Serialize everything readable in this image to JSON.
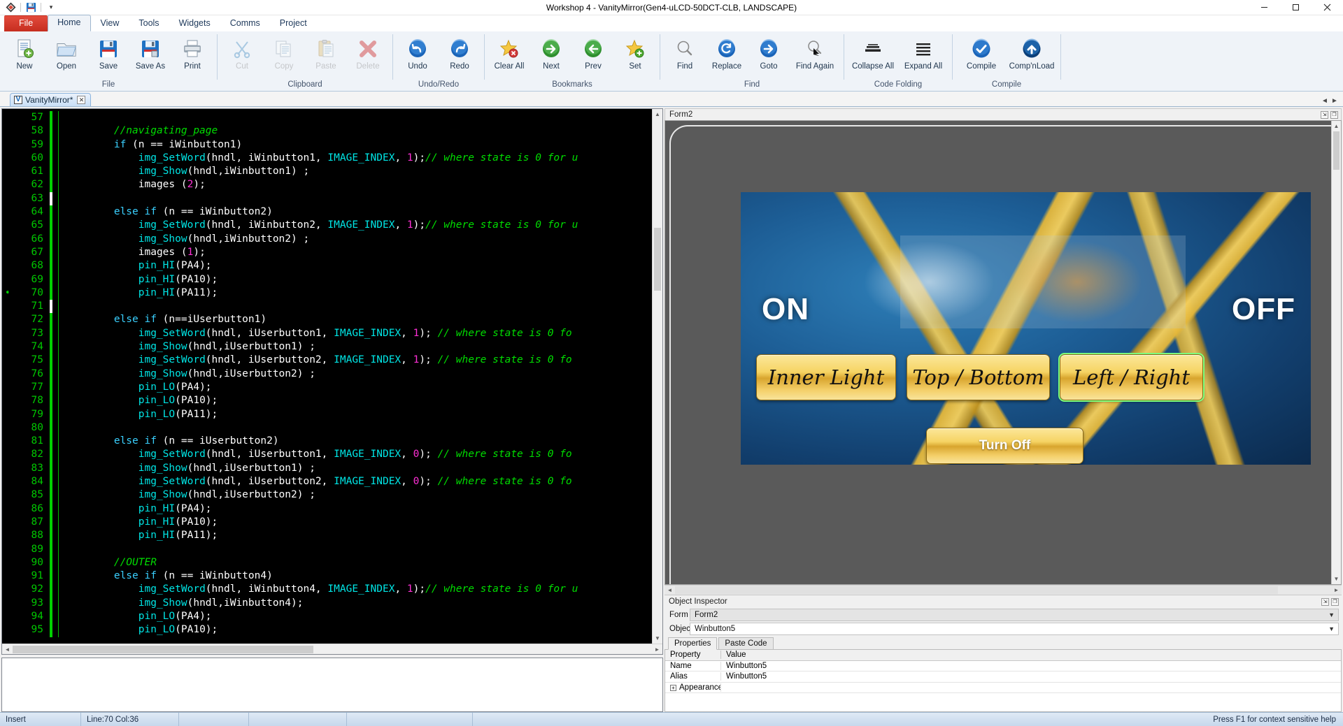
{
  "window": {
    "title": "Workshop 4 - VanityMirror(Gen4-uLCD-50DCT-CLB, LANDSCAPE)",
    "minimize": "—",
    "maximize": "❐",
    "close": "✕"
  },
  "quick_access": {
    "logo": "app-logo",
    "save": "save-icon",
    "more": "▾"
  },
  "ribbon": {
    "tabs": [
      {
        "label": "File",
        "kind": "file"
      },
      {
        "label": "Home",
        "kind": "active"
      },
      {
        "label": "View",
        "kind": "normal"
      },
      {
        "label": "Tools",
        "kind": "normal"
      },
      {
        "label": "Widgets",
        "kind": "normal"
      },
      {
        "label": "Comms",
        "kind": "normal"
      },
      {
        "label": "Project",
        "kind": "normal"
      }
    ],
    "groups": [
      {
        "label": "File",
        "buttons": [
          {
            "label": "New",
            "icon": "new-document-icon",
            "enabled": true
          },
          {
            "label": "Open",
            "icon": "open-folder-icon",
            "enabled": true
          },
          {
            "label": "Save",
            "icon": "save-disk-icon",
            "enabled": true
          },
          {
            "label": "Save As",
            "icon": "save-as-disk-icon",
            "enabled": true
          },
          {
            "label": "Print",
            "icon": "printer-icon",
            "enabled": true
          }
        ]
      },
      {
        "label": "Clipboard",
        "buttons": [
          {
            "label": "Cut",
            "icon": "scissors-icon",
            "enabled": false
          },
          {
            "label": "Copy",
            "icon": "copy-icon",
            "enabled": false
          },
          {
            "label": "Paste",
            "icon": "clipboard-icon",
            "enabled": false
          },
          {
            "label": "Delete",
            "icon": "red-x-icon",
            "enabled": false
          }
        ]
      },
      {
        "label": "Undo/Redo",
        "buttons": [
          {
            "label": "Undo",
            "icon": "undo-arrow-icon",
            "enabled": true
          },
          {
            "label": "Redo",
            "icon": "redo-arrow-icon",
            "enabled": true
          }
        ]
      },
      {
        "label": "Bookmarks",
        "buttons": [
          {
            "label": "Clear All",
            "icon": "star-delete-icon",
            "enabled": true
          },
          {
            "label": "Next",
            "icon": "green-right-arrow-icon",
            "enabled": true
          },
          {
            "label": "Prev",
            "icon": "green-left-arrow-icon",
            "enabled": true
          },
          {
            "label": "Set",
            "icon": "star-add-icon",
            "enabled": true
          }
        ]
      },
      {
        "label": "Find",
        "buttons": [
          {
            "label": "Find",
            "icon": "magnifier-icon",
            "enabled": true
          },
          {
            "label": "Replace",
            "icon": "replace-refresh-icon",
            "enabled": true
          },
          {
            "label": "Goto",
            "icon": "blue-right-arrow-icon",
            "enabled": true
          },
          {
            "label": "Find Again",
            "icon": "find-again-icon",
            "enabled": true
          }
        ]
      },
      {
        "label": "Code Folding",
        "buttons": [
          {
            "label": "Collapse All",
            "icon": "collapse-lines-icon",
            "enabled": true
          },
          {
            "label": "Expand All",
            "icon": "expand-lines-icon",
            "enabled": true
          }
        ]
      },
      {
        "label": "Compile",
        "buttons": [
          {
            "label": "Compile",
            "icon": "compile-check-icon",
            "enabled": true
          },
          {
            "label": "Comp'nLoad",
            "icon": "compile-upload-icon",
            "enabled": true
          }
        ]
      }
    ]
  },
  "doc_tabs": {
    "tabs": [
      {
        "label": "VanityMirror*",
        "icon": "project-v-icon",
        "close": "✕"
      }
    ],
    "nav_left": "◄",
    "nav_right": "►"
  },
  "editor": {
    "first_line": 57,
    "current_line_marker_at": 70,
    "lines": [
      {
        "n": 57,
        "tokens": []
      },
      {
        "n": 58,
        "tokens": [
          {
            "t": "        ",
            "c": "pl"
          },
          {
            "t": "//navigating_page",
            "c": "com"
          }
        ]
      },
      {
        "n": 59,
        "tokens": [
          {
            "t": "        ",
            "c": "pl"
          },
          {
            "t": "if",
            "c": "kw"
          },
          {
            "t": " (n == iWinbutton1)",
            "c": "id"
          }
        ]
      },
      {
        "n": 60,
        "tokens": [
          {
            "t": "            ",
            "c": "pl"
          },
          {
            "t": "img_SetWord",
            "c": "fn"
          },
          {
            "t": "(hndl, iWinbutton1, ",
            "c": "id"
          },
          {
            "t": "IMAGE_INDEX",
            "c": "cn"
          },
          {
            "t": ", ",
            "c": "id"
          },
          {
            "t": "1",
            "c": "num"
          },
          {
            "t": ");",
            "c": "id"
          },
          {
            "t": "// where state is 0 for u",
            "c": "com"
          }
        ]
      },
      {
        "n": 61,
        "tokens": [
          {
            "t": "            ",
            "c": "pl"
          },
          {
            "t": "img_Show",
            "c": "fn"
          },
          {
            "t": "(hndl,iWinbutton1) ;",
            "c": "id"
          }
        ]
      },
      {
        "n": 62,
        "tokens": [
          {
            "t": "            ",
            "c": "pl"
          },
          {
            "t": "images (",
            "c": "id"
          },
          {
            "t": "2",
            "c": "num"
          },
          {
            "t": ");",
            "c": "id"
          }
        ]
      },
      {
        "n": 63,
        "tokens": []
      },
      {
        "n": 64,
        "tokens": [
          {
            "t": "        ",
            "c": "pl"
          },
          {
            "t": "else if",
            "c": "kw"
          },
          {
            "t": " (n == iWinbutton2)",
            "c": "id"
          }
        ]
      },
      {
        "n": 65,
        "tokens": [
          {
            "t": "            ",
            "c": "pl"
          },
          {
            "t": "img_SetWord",
            "c": "fn"
          },
          {
            "t": "(hndl, iWinbutton2, ",
            "c": "id"
          },
          {
            "t": "IMAGE_INDEX",
            "c": "cn"
          },
          {
            "t": ", ",
            "c": "id"
          },
          {
            "t": "1",
            "c": "num"
          },
          {
            "t": ");",
            "c": "id"
          },
          {
            "t": "// where state is 0 for u",
            "c": "com"
          }
        ]
      },
      {
        "n": 66,
        "tokens": [
          {
            "t": "            ",
            "c": "pl"
          },
          {
            "t": "img_Show",
            "c": "fn"
          },
          {
            "t": "(hndl,iWinbutton2) ;",
            "c": "id"
          }
        ]
      },
      {
        "n": 67,
        "tokens": [
          {
            "t": "            ",
            "c": "pl"
          },
          {
            "t": "images (",
            "c": "id"
          },
          {
            "t": "1",
            "c": "num"
          },
          {
            "t": ");",
            "c": "id"
          }
        ]
      },
      {
        "n": 68,
        "tokens": [
          {
            "t": "            ",
            "c": "pl"
          },
          {
            "t": "pin_HI",
            "c": "fn"
          },
          {
            "t": "(PA4);",
            "c": "id"
          }
        ]
      },
      {
        "n": 69,
        "tokens": [
          {
            "t": "            ",
            "c": "pl"
          },
          {
            "t": "pin_HI",
            "c": "fn"
          },
          {
            "t": "(PA10);",
            "c": "id"
          }
        ]
      },
      {
        "n": 70,
        "tokens": [
          {
            "t": "            ",
            "c": "pl"
          },
          {
            "t": "pin_HI",
            "c": "fn"
          },
          {
            "t": "(PA11);",
            "c": "id"
          }
        ]
      },
      {
        "n": 71,
        "tokens": []
      },
      {
        "n": 72,
        "tokens": [
          {
            "t": "        ",
            "c": "pl"
          },
          {
            "t": "else if",
            "c": "kw"
          },
          {
            "t": " (n==iUserbutton1)",
            "c": "id"
          }
        ]
      },
      {
        "n": 73,
        "tokens": [
          {
            "t": "            ",
            "c": "pl"
          },
          {
            "t": "img_SetWord",
            "c": "fn"
          },
          {
            "t": "(hndl, iUserbutton1, ",
            "c": "id"
          },
          {
            "t": "IMAGE_INDEX",
            "c": "cn"
          },
          {
            "t": ", ",
            "c": "id"
          },
          {
            "t": "1",
            "c": "num"
          },
          {
            "t": "); ",
            "c": "id"
          },
          {
            "t": "// where state is 0 fo",
            "c": "com"
          }
        ]
      },
      {
        "n": 74,
        "tokens": [
          {
            "t": "            ",
            "c": "pl"
          },
          {
            "t": "img_Show",
            "c": "fn"
          },
          {
            "t": "(hndl,iUserbutton1) ;",
            "c": "id"
          }
        ]
      },
      {
        "n": 75,
        "tokens": [
          {
            "t": "            ",
            "c": "pl"
          },
          {
            "t": "img_SetWord",
            "c": "fn"
          },
          {
            "t": "(hndl, iUserbutton2, ",
            "c": "id"
          },
          {
            "t": "IMAGE_INDEX",
            "c": "cn"
          },
          {
            "t": ", ",
            "c": "id"
          },
          {
            "t": "1",
            "c": "num"
          },
          {
            "t": "); ",
            "c": "id"
          },
          {
            "t": "// where state is 0 fo",
            "c": "com"
          }
        ]
      },
      {
        "n": 76,
        "tokens": [
          {
            "t": "            ",
            "c": "pl"
          },
          {
            "t": "img_Show",
            "c": "fn"
          },
          {
            "t": "(hndl,iUserbutton2) ;",
            "c": "id"
          }
        ]
      },
      {
        "n": 77,
        "tokens": [
          {
            "t": "            ",
            "c": "pl"
          },
          {
            "t": "pin_LO",
            "c": "fn"
          },
          {
            "t": "(PA4);",
            "c": "id"
          }
        ]
      },
      {
        "n": 78,
        "tokens": [
          {
            "t": "            ",
            "c": "pl"
          },
          {
            "t": "pin_LO",
            "c": "fn"
          },
          {
            "t": "(PA10);",
            "c": "id"
          }
        ]
      },
      {
        "n": 79,
        "tokens": [
          {
            "t": "            ",
            "c": "pl"
          },
          {
            "t": "pin_LO",
            "c": "fn"
          },
          {
            "t": "(PA11);",
            "c": "id"
          }
        ]
      },
      {
        "n": 80,
        "tokens": []
      },
      {
        "n": 81,
        "tokens": [
          {
            "t": "        ",
            "c": "pl"
          },
          {
            "t": "else if",
            "c": "kw"
          },
          {
            "t": " (n == iUserbutton2)",
            "c": "id"
          }
        ]
      },
      {
        "n": 82,
        "tokens": [
          {
            "t": "            ",
            "c": "pl"
          },
          {
            "t": "img_SetWord",
            "c": "fn"
          },
          {
            "t": "(hndl, iUserbutton1, ",
            "c": "id"
          },
          {
            "t": "IMAGE_INDEX",
            "c": "cn"
          },
          {
            "t": ", ",
            "c": "id"
          },
          {
            "t": "0",
            "c": "num"
          },
          {
            "t": "); ",
            "c": "id"
          },
          {
            "t": "// where state is 0 fo",
            "c": "com"
          }
        ]
      },
      {
        "n": 83,
        "tokens": [
          {
            "t": "            ",
            "c": "pl"
          },
          {
            "t": "img_Show",
            "c": "fn"
          },
          {
            "t": "(hndl,iUserbutton1) ;",
            "c": "id"
          }
        ]
      },
      {
        "n": 84,
        "tokens": [
          {
            "t": "            ",
            "c": "pl"
          },
          {
            "t": "img_SetWord",
            "c": "fn"
          },
          {
            "t": "(hndl, iUserbutton2, ",
            "c": "id"
          },
          {
            "t": "IMAGE_INDEX",
            "c": "cn"
          },
          {
            "t": ", ",
            "c": "id"
          },
          {
            "t": "0",
            "c": "num"
          },
          {
            "t": "); ",
            "c": "id"
          },
          {
            "t": "// where state is 0 fo",
            "c": "com"
          }
        ]
      },
      {
        "n": 85,
        "tokens": [
          {
            "t": "            ",
            "c": "pl"
          },
          {
            "t": "img_Show",
            "c": "fn"
          },
          {
            "t": "(hndl,iUserbutton2) ;",
            "c": "id"
          }
        ]
      },
      {
        "n": 86,
        "tokens": [
          {
            "t": "            ",
            "c": "pl"
          },
          {
            "t": "pin_HI",
            "c": "fn"
          },
          {
            "t": "(PA4);",
            "c": "id"
          }
        ]
      },
      {
        "n": 87,
        "tokens": [
          {
            "t": "            ",
            "c": "pl"
          },
          {
            "t": "pin_HI",
            "c": "fn"
          },
          {
            "t": "(PA10);",
            "c": "id"
          }
        ]
      },
      {
        "n": 88,
        "tokens": [
          {
            "t": "            ",
            "c": "pl"
          },
          {
            "t": "pin_HI",
            "c": "fn"
          },
          {
            "t": "(PA11);",
            "c": "id"
          }
        ]
      },
      {
        "n": 89,
        "tokens": []
      },
      {
        "n": 90,
        "tokens": [
          {
            "t": "        ",
            "c": "pl"
          },
          {
            "t": "//OUTER",
            "c": "com"
          }
        ]
      },
      {
        "n": 91,
        "tokens": [
          {
            "t": "        ",
            "c": "pl"
          },
          {
            "t": "else if",
            "c": "kw"
          },
          {
            "t": " (n == iWinbutton4)",
            "c": "id"
          }
        ]
      },
      {
        "n": 92,
        "tokens": [
          {
            "t": "            ",
            "c": "pl"
          },
          {
            "t": "img_SetWord",
            "c": "fn"
          },
          {
            "t": "(hndl, iWinbutton4, ",
            "c": "id"
          },
          {
            "t": "IMAGE_INDEX",
            "c": "cn"
          },
          {
            "t": ", ",
            "c": "id"
          },
          {
            "t": "1",
            "c": "num"
          },
          {
            "t": ");",
            "c": "id"
          },
          {
            "t": "// where state is 0 for u",
            "c": "com"
          }
        ]
      },
      {
        "n": 93,
        "tokens": [
          {
            "t": "            ",
            "c": "pl"
          },
          {
            "t": "img_Show",
            "c": "fn"
          },
          {
            "t": "(hndl,iWinbutton4);",
            "c": "id"
          }
        ]
      },
      {
        "n": 94,
        "tokens": [
          {
            "t": "            ",
            "c": "pl"
          },
          {
            "t": "pin_LO",
            "c": "fn"
          },
          {
            "t": "(PA4);",
            "c": "id"
          }
        ]
      },
      {
        "n": 95,
        "tokens": [
          {
            "t": "            ",
            "c": "pl"
          },
          {
            "t": "pin_LO",
            "c": "fn"
          },
          {
            "t": "(PA10);",
            "c": "id"
          }
        ]
      }
    ]
  },
  "form_panel": {
    "header": "Form2",
    "screen": {
      "label_on": "ON",
      "label_off": "OFF",
      "buttons": [
        {
          "name": "Inner Light",
          "style": "script",
          "selected": false
        },
        {
          "name": "Top / Bottom",
          "style": "script",
          "selected": false
        },
        {
          "name": "Left / Right",
          "style": "script",
          "selected": true
        },
        {
          "name": "Turn Off",
          "style": "plain",
          "selected": false
        }
      ]
    }
  },
  "object_inspector": {
    "header": "Object Inspector",
    "form_label": "Form",
    "form_value": "Form2",
    "object_label": "Object",
    "object_value": "Winbutton5",
    "tabs": [
      {
        "label": "Properties",
        "active": true
      },
      {
        "label": "Paste Code",
        "active": false
      }
    ],
    "columns": [
      "Property",
      "Value"
    ],
    "rows": [
      {
        "property": "Name",
        "value": "Winbutton5",
        "expandable": false
      },
      {
        "property": "Alias",
        "value": "Winbutton5",
        "expandable": false
      },
      {
        "property": "Appearance",
        "value": "",
        "expandable": true
      }
    ]
  },
  "status_bar": {
    "mode": "Insert",
    "position": "Line:70 Col:36",
    "cell3": "",
    "cell4": "",
    "cell5": "",
    "hint": "Press F1 for context sensitive help"
  }
}
